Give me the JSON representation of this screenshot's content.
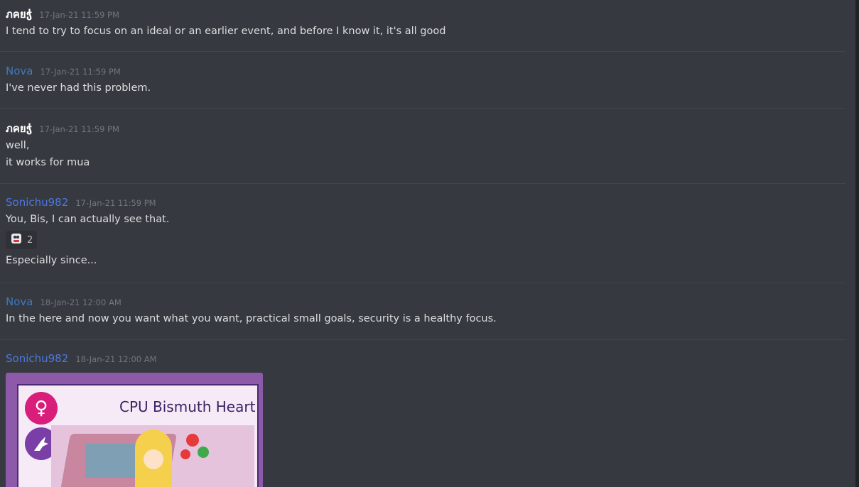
{
  "messages": [
    {
      "author": "ภคยჭ",
      "timestamp": "17-Jan-21 11:59 PM",
      "lines": [
        "I tend to try to focus on an ideal or an earlier event, and before I know it, it's all good"
      ]
    },
    {
      "author": "Nova",
      "timestamp": "17-Jan-21 11:59 PM",
      "lines": [
        "I've never had this problem."
      ]
    },
    {
      "author": "ภคยჭ",
      "timestamp": "17-Jan-21 11:59 PM",
      "lines": [
        "well,",
        "it works for mua"
      ]
    },
    {
      "author": "Sonichu982",
      "timestamp": "17-Jan-21 11:59 PM",
      "lines": [
        "You, Bis, I can actually see that."
      ],
      "reaction": {
        "icon": "sticker-emoji-icon",
        "count": "2"
      },
      "after_lines": [
        "Especially since..."
      ]
    },
    {
      "author": "Nova",
      "timestamp": "18-Jan-21 12:00 AM",
      "lines": [
        "In the here and now you want what you want, practical small goals, security is a healthy focus."
      ]
    },
    {
      "author": "Sonichu982",
      "timestamp": "18-Jan-21 12:00 AM",
      "attachment": {
        "title": "CPU Bismuth Heart",
        "icons": [
          "female-symbol-icon",
          "unicorn-icon"
        ]
      }
    }
  ],
  "colors": {
    "background": "#36393f",
    "nova": "#3d7ac2",
    "sonichu": "#4d77e0",
    "timestamp": "#72767d"
  }
}
